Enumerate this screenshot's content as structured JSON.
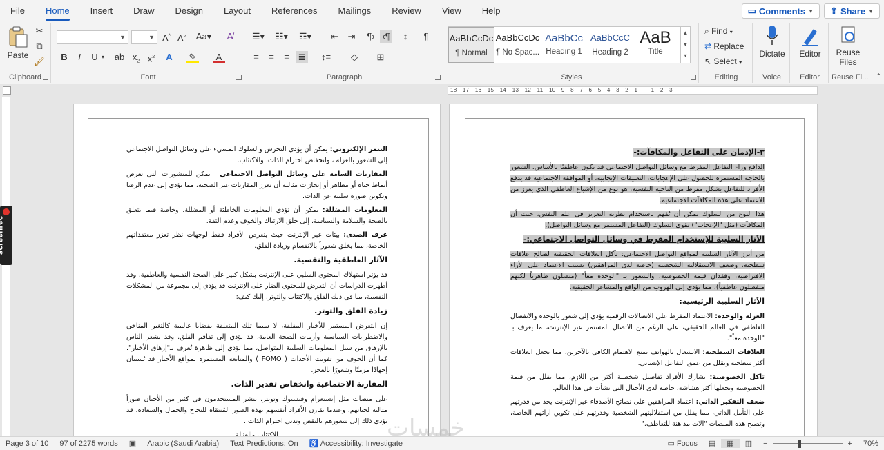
{
  "menu": {
    "tabs": [
      "File",
      "Home",
      "Insert",
      "Draw",
      "Design",
      "Layout",
      "References",
      "Mailings",
      "Review",
      "View",
      "Help"
    ],
    "comments": "Comments",
    "share": "Share"
  },
  "ribbon": {
    "clipboard": {
      "label": "Clipboard",
      "paste": "Paste"
    },
    "font": {
      "label": "Font",
      "name": "",
      "size": ""
    },
    "paragraph": {
      "label": "Paragraph"
    },
    "styles": {
      "label": "Styles",
      "items": [
        {
          "sample": "AaBbCcDc",
          "name": "¶ Normal"
        },
        {
          "sample": "AaBbCcDc",
          "name": "¶ No Spac..."
        },
        {
          "sample": "AaBbCc",
          "name": "Heading 1"
        },
        {
          "sample": "AaBbCcC",
          "name": "Heading 2"
        },
        {
          "sample": "AaB",
          "name": "Title"
        }
      ]
    },
    "editing": {
      "label": "Editing",
      "find": "Find",
      "replace": "Replace",
      "select": "Select"
    },
    "voice": {
      "label": "Voice",
      "dictate": "Dictate"
    },
    "editor": {
      "label": "Editor",
      "editor": "Editor"
    },
    "reuse": {
      "label": "Reuse Fi...",
      "reuse": "Reuse Files"
    }
  },
  "ruler": {
    "text": "·18· ·17· ·16· ·15· ·14· ·13· ·12· ·11· ·10· ·9· ·8· ·7· ·6· ·5· ·4· ·3· ·2· ·1· · · ·1· ·2· ·3·"
  },
  "left_page": {
    "p1_b": "التنمر الإلكتروني:",
    "p1": " يمكن أن يؤدي التحرش والسلوك المسيء على وسائل التواصل الاجتماعي إلى الشعور بالعزلة ، وانخفاض احترام الذات، والاكتئاب.",
    "p2_b": "المقارنات السامة على وسائل التواصل الاجتماعي",
    "p2": " : يمكن للمنشورات التي تعرض أنماط حياة أو مظاهر أو إنجازات مثالية أن تعزز المقارنات غير الصحية، مما يؤدي إلى عدم الرضا وتكوين صورة سلبية عن الذات.",
    "p3_b": "المعلومات المضللة:",
    "p3": " يمكن أن تؤدي المعلومات الخاطئة أو المضللة، وخاصة فيما يتعلق بالصحة والسلامة والسياسة، إلى خلق الارتباك والخوف وعدم الثقة.",
    "p4_b": "غرف الصدى:",
    "p4": " بيئات عبر الإنترنت حيث يتعرض الأفراد فقط لوجهات نظر تعزز معتقداتهم الخاصة، مما يخلق شعوراً بالانقسام وزيادة القلق.",
    "h1": "الآثار العاطفية والنفسية.",
    "p5": "قد يؤثر استهلاك المحتوى السلبي على الإنترنت بشكل كبير على الصحة النفسية والعاطفية. وقد أظهرت الدراسات أن التعرض للمحتوى الضار على الإنترنت قد يؤدي إلى مجموعة من المشكلات النفسية، بما في ذلك القلق والاكتئاب والتوتر. إليك كيف:",
    "h2": "زيادة القلق والتوتر.",
    "p6": "إن التعرض المستمر للأخبار المقلقة، لا سيما تلك المتعلقة بقضايا عالمية كالتغير المناخي والاضطرابات السياسية وأزمات الصحة العامة، قد يؤدي إلى تفاقم القلق. وقد يشعر الناس بالإرهاق من سيل المعلومات السلبية المتواصل، مما يؤدي إلى ظاهرة تُعرف بـ\"إرهاق الأخبار\". كما أن الخوف من تفويت الأحداث ( FOMO ) والمتابعة المستمرة لمواقع الأخبار قد يُسببان إجهادًا مزمنًا وشعورًا بالعجز.",
    "h3": "المقارنة الاجتماعية وانخفاض تقدير الذات.",
    "p7": "على منصات مثل إنستغرام وفيسبوك وتويتر، ينشر المستخدمون في كثير من الأحيان صوراً مثالية لحياتهم. وعندما يقارن الأفراد أنفسهم بهذه الصور المُنتقاة للنجاح والجمال والسعادة، قد يؤدي ذلك إلى شعورهم بالنقص وتدني احترام الذات .",
    "p8": "الاكتئاب والعزلة"
  },
  "right_page": {
    "h1": "٣-الإدمان على التفاعل والمكافآت:-",
    "p1": "الدافع وراء التفاعل المفرط مع وسائل التواصل الاجتماعي قد يكون عاطفيًا بالأساس. الشعور بالحاجة المستمرة للحصول على الإعجابات، التعليقات الإيجابية، أو الموافقة الاجتماعية قد يدفع الأفراد للتفاعل بشكل مفرط من الناحية النفسية، هو نوع من الإشباع العاطفي الذي يعزز من الاعتماد على هذه المكافآت الاجتماعية.",
    "p2": "هذا النوع من السلوك يمكن أن يُفهم باستخدام نظرية التعزيز في علم النفس، حيث أن المكافآت (مثل \"الإعجاب\") تقوي السلوك (التفاعل المستمر مع وسائل التواصل).",
    "h2": "الآثار السلبية للإستخدام المفرط في وسائل التواصل الاجتماعي:-",
    "p3": "من أبرز الآثار السلبية لمواقع التواصل الاجتماعي: تآكل العلاقات الحقيقية لصالح علاقات سطحية، وضعف الاستقلالية الشخصية (خاصة لدى المراهقين) بسبب الاعتماد على الأراء الافتراضية، وفقدان قيمة الخصوصية، والشعور بـ \"الوحدة معاً\" (متصلون ظاهرياً لكنهم منفصلون عاطفياً)، مما يؤدي إلى الهروب من الواقع والمشاعر الحقيقية.",
    "h3": "الآثار السلبية الرئيسية:",
    "p4_b": "العزلة والوحدة:",
    "p4": " الاعتماد المفرط على الاتصالات الرقمية يؤدي إلى شعور بالوحدة والانفصال العاطفي في العالم الحقيقي، على الرغم من الاتصال المستمر عبر الإنترنت، ما يعرف بـ \"الوحدة معاً\".",
    "p5_b": "العلاقات السطحية:",
    "p5": " الانشغال بالهواتف يمنع الاهتمام الكافي بالآخرين، مما يجعل العلاقات أكثر سطحية ويقلل من عمق التفاعل الإنساني.",
    "p6_b": "تآكل الخصوصية:",
    "p6": " يشارك الأفراد تفاصيل شخصية أكثر من اللازم، مما يقلل من قيمة الخصوصية ويجعلها أكثر هشاشة، خاصة لدى الأجيال التي نشأت في هذا العالم.",
    "p7_b": "ضعف التفكير الذاتي:",
    "p7": " اعتماد المراهقين على نصائح الأصدقاء عبر الإنترنت يحد من قدرتهم على التأمل الذاتي، مما يقلل من استقلاليتهم الشخصية وقدرتهم على تكوين آرائهم الخاصة، وتصبح هذه المنصات \"آلات مداهنة للتعاطف.\""
  },
  "status": {
    "page": "Page 3 of 10",
    "words": "97 of 2275 words",
    "lang": "Arabic (Saudi Arabia)",
    "predictions": "Text Predictions: On",
    "accessibility": "Accessibility: Investigate",
    "focus": "Focus",
    "zoom": "70%"
  },
  "watermark": "خمسات",
  "screenrec": "screenrec"
}
